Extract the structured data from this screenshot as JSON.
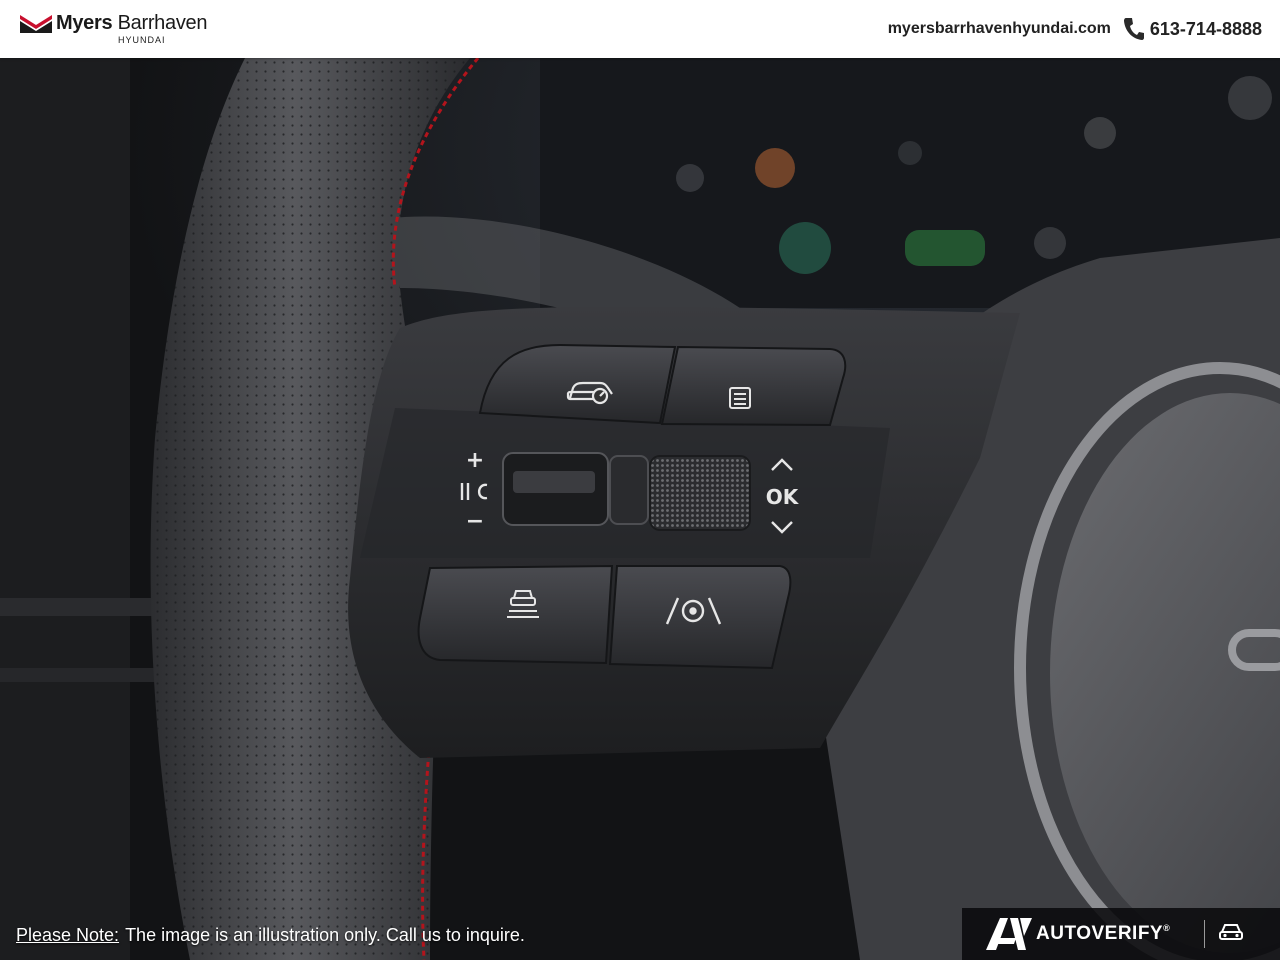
{
  "header": {
    "brand_name": "Myers",
    "brand_location": "Barrhaven",
    "brand_sub": "HYUNDAI",
    "website": "myersbarrhavenhyundai.com",
    "phone": "613-714-8888"
  },
  "photo": {
    "button_labels": {
      "plus": "+",
      "minus": "−",
      "ok": "OK"
    }
  },
  "footer": {
    "note_label": "Please Note:",
    "note_text": "The image is an illustration only. Call us to inquire.",
    "badge_text": "AUTOVERIFY",
    "badge_reg": "®"
  },
  "colors": {
    "header_bg": "#ffffff",
    "brand_red": "#c8102e",
    "stitch_red": "#b3141c",
    "text_dark": "#222222"
  }
}
